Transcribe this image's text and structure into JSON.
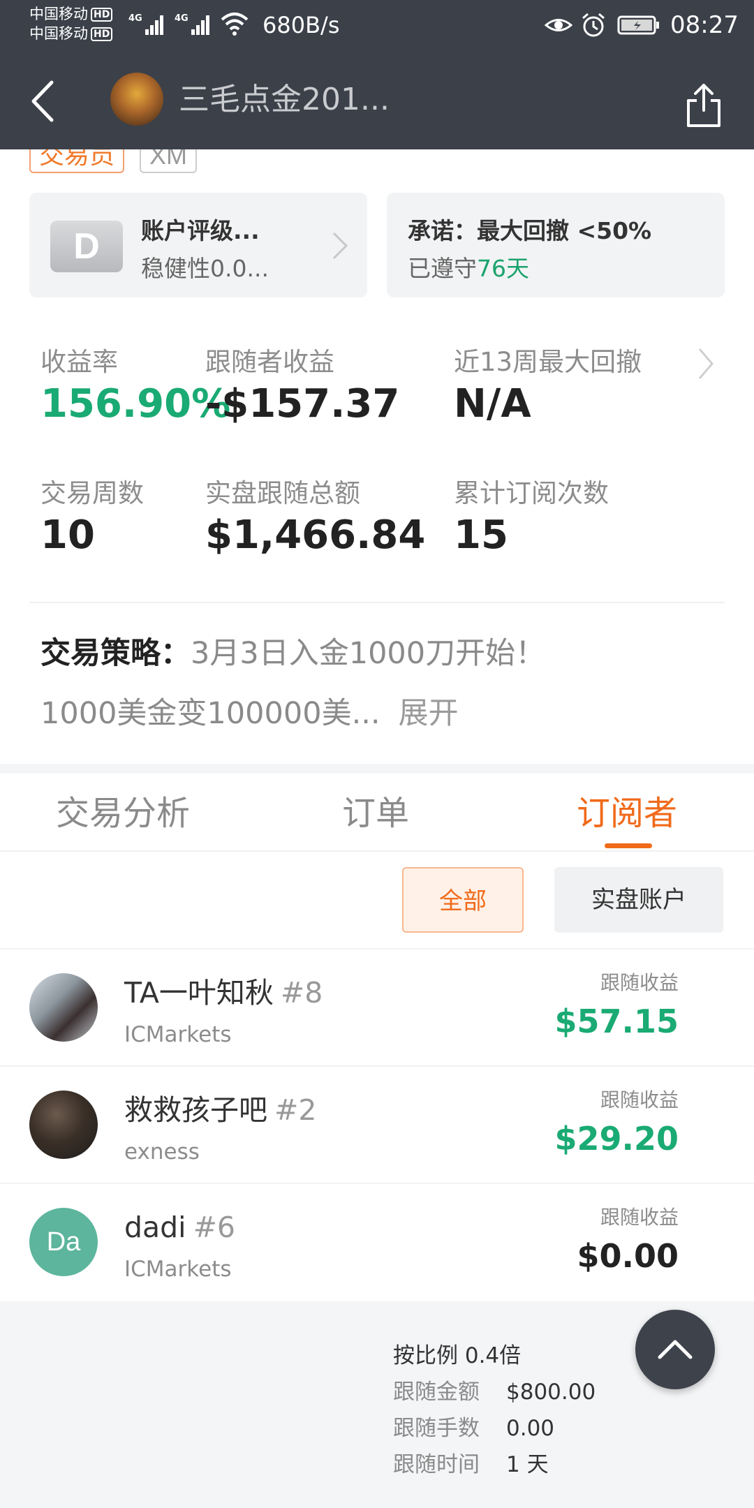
{
  "status_bar": {
    "carrier_1": "中国移动",
    "carrier_2": "中国移动",
    "hd": "HD",
    "net_1": "4G",
    "net_2": "4G",
    "speed": "680B/s",
    "time": "08:27"
  },
  "header": {
    "title": "三毛点金201...",
    "back_icon": "back-arrow-icon",
    "share_icon": "share-icon"
  },
  "tags": {
    "trader": "交易员",
    "broker": "XM"
  },
  "rating_card": {
    "badge": "D",
    "title": "账户评级...",
    "subtitle": "稳健性0.0..."
  },
  "promise_card": {
    "title": "承诺：最大回撤 <50%",
    "kept_prefix": "已遵守",
    "kept_days": "76天"
  },
  "stats": {
    "return_label": "收益率",
    "return_value": "156.90%",
    "follower_profit_label": "跟随者收益",
    "follower_profit_value": "-$157.37",
    "max_drawdown_label": "近13周最大回撤",
    "max_drawdown_value": "N/A",
    "weeks_label": "交易周数",
    "weeks_value": "10",
    "real_follow_label": "实盘跟随总额",
    "real_follow_value": "$1,466.84",
    "subscriptions_label": "累计订阅次数",
    "subscriptions_value": "15"
  },
  "strategy": {
    "label": "交易策略：",
    "line1": "3月3日入金1000刀开始！",
    "line2": "1000美金变100000美...",
    "expand": "展开"
  },
  "tabs": [
    {
      "label": "交易分析"
    },
    {
      "label": "订单"
    },
    {
      "label": "订阅者"
    }
  ],
  "filters": {
    "all": "全部",
    "real": "实盘账户"
  },
  "subscribers": [
    {
      "name": "TA一叶知秋",
      "rank": "#8",
      "broker": "ICMarkets",
      "earn_label": "跟随收益",
      "earn_value": "$57.15"
    },
    {
      "name": "救救孩子吧",
      "rank": "#2",
      "broker": "exness",
      "earn_label": "跟随收益",
      "earn_value": "$29.20"
    },
    {
      "name": "dadi",
      "rank": "#6",
      "broker": "ICMarkets",
      "earn_label": "跟随收益",
      "earn_value": "$0.00",
      "avatar_text": "Da"
    }
  ],
  "follow_details": {
    "ratio": "按比例 0.4倍",
    "amount_label": "跟随金额",
    "amount_value": "$800.00",
    "lots_label": "跟随手数",
    "lots_value": "0.00",
    "time_label": "跟随时间",
    "time_value": "1 天"
  },
  "colors": {
    "header_bg": "#3b4049",
    "accent_orange": "#f06a1a",
    "profit_green": "#1aaa73"
  }
}
